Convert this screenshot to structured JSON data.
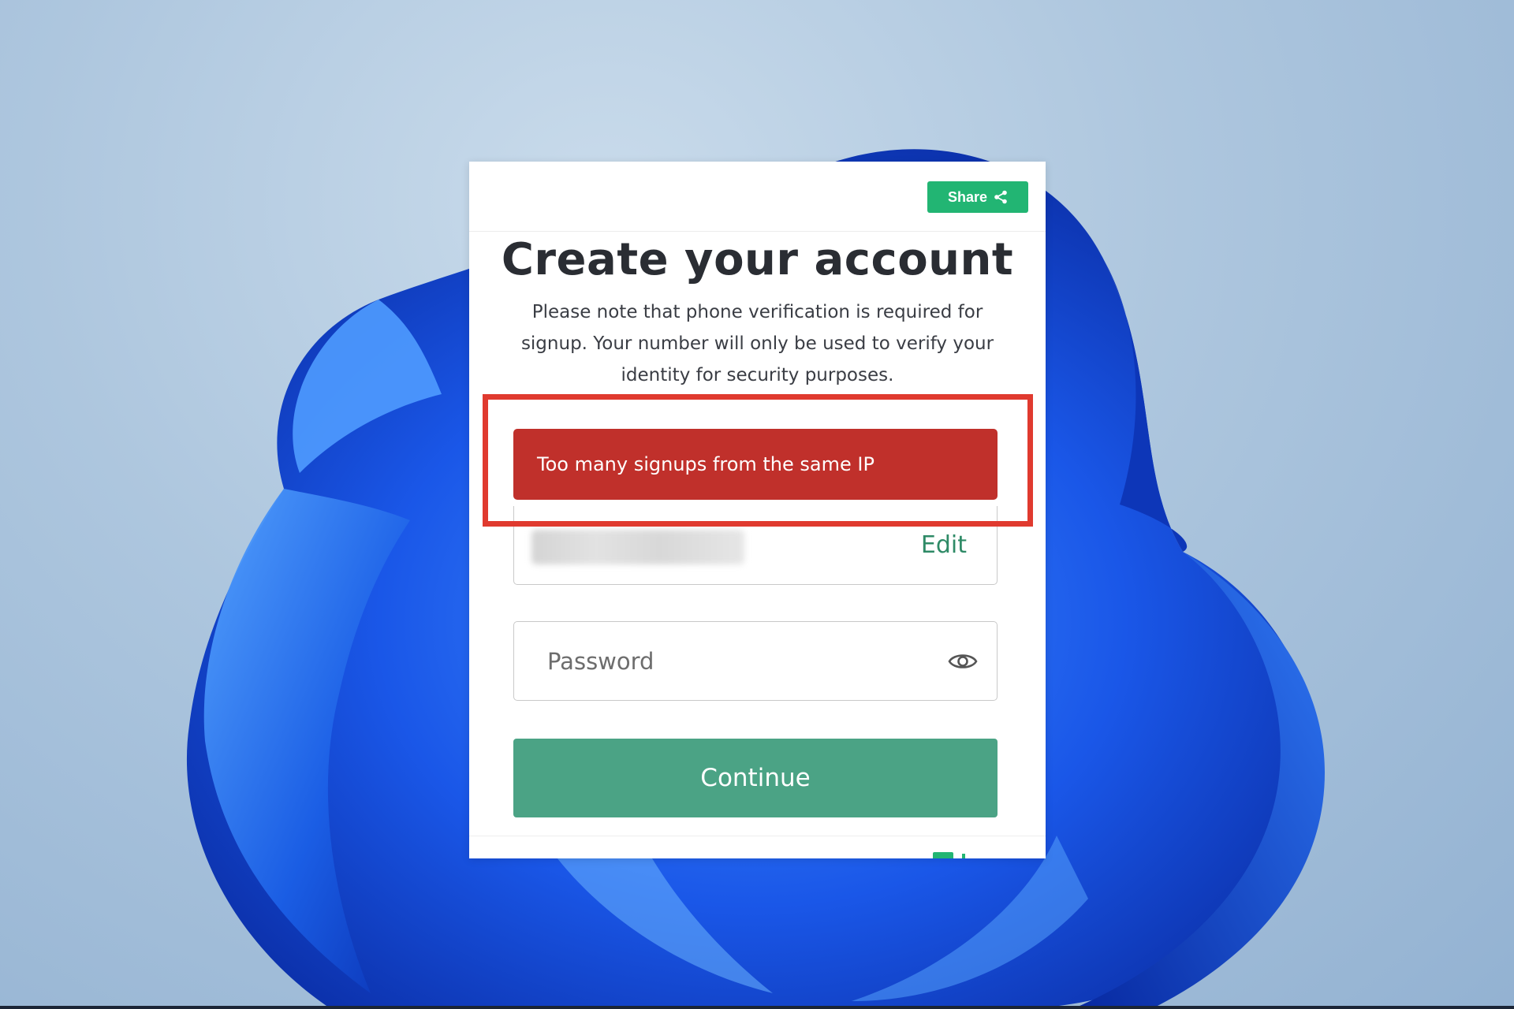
{
  "signup": {
    "share_label": "Share",
    "share_icon": "share-icon",
    "title": "Create your account",
    "notice": "Please note that phone verification is required for signup. Your number will only be used to verify your identity for security purposes.",
    "error_message": "Too many signups from the same IP",
    "email_edit_label": "Edit",
    "password_placeholder": "Password",
    "password_toggle_icon": "eye-icon",
    "continue_label": "Continue"
  },
  "colors": {
    "share_green": "#22b573",
    "error_red": "#c0302b",
    "highlight_red": "#e03a2f",
    "continue_green": "#4ba385",
    "edit_green": "#2e8a66"
  }
}
